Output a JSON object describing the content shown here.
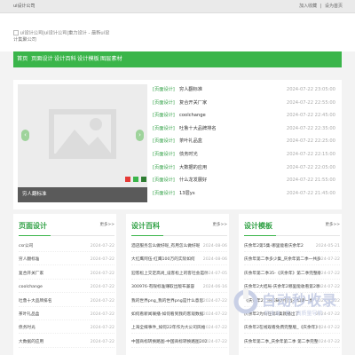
{
  "topbar": {
    "site_name": "ui设计公司",
    "favorites": "加入收藏",
    "sep": "|",
    "homepage": "设为首页"
  },
  "logo": {
    "text": "ui设计公司|ui设计公司|重力设计 - 最新ui设计集聚公司"
  },
  "nav": [
    "首页",
    "页面设计",
    "设计百科",
    "设计模板",
    "图层素材"
  ],
  "slider": {
    "caption": "穷人翻标准",
    "prev": "‹",
    "next": "›"
  },
  "hero_list": [
    {
      "tag": "[页面设计]",
      "title": "穷人翻标准",
      "time": "2024-07-22 23:05:00"
    },
    {
      "tag": "[页面设计]",
      "title": "复合开关厂家",
      "time": "2024-07-22 22:55:00"
    },
    {
      "tag": "[页面设计]",
      "title": "coolchange",
      "time": "2024-07-22 22:45:00"
    },
    {
      "tag": "[页面设计]",
      "title": "吐鲁十大品牌排名",
      "time": "2024-07-22 22:35:00"
    },
    {
      "tag": "[页面设计]",
      "title": "茶叶礼品盒",
      "time": "2024-07-22 22:25:00"
    },
    {
      "tag": "[页面设计]",
      "title": "债务时光",
      "time": "2024-07-22 22:15:00"
    },
    {
      "tag": "[页面设计]",
      "title": "大数据的应用",
      "time": "2024-07-22 22:05:00"
    },
    {
      "tag": "[页面设计]",
      "title": "什么龙发展好",
      "time": "2024-07-22 21:55:00"
    },
    {
      "tag": "[页面设计]",
      "title": "13层ys",
      "time": "2024-07-22 21:45:00"
    }
  ],
  "columns": [
    {
      "title": "页面设计",
      "more": "更多>>",
      "items": [
        {
          "text": "csr公司",
          "date": "2024-07-22"
        },
        {
          "text": "穷人翻标准",
          "date": "2024-07-22"
        },
        {
          "text": "复合开关厂家",
          "date": "2024-07-22"
        },
        {
          "text": "coolchange",
          "date": "2024-07-22"
        },
        {
          "text": "吐鲁十大品牌排名",
          "date": "2024-07-22"
        },
        {
          "text": "茶叶礼品盒",
          "date": "2024-07-22"
        },
        {
          "text": "债务时光",
          "date": "2024-07-22"
        },
        {
          "text": "大数据的应用",
          "date": "2024-07-22"
        }
      ]
    },
    {
      "title": "设计百科",
      "more": "更多>>",
      "items": [
        {
          "text": "酒店服务怎么做好呢_有用怎么做好呢",
          "date": "2024-08-06"
        },
        {
          "text": "大红鹰阿伍-红鹰100万的实际如何",
          "date": "2024-08-06"
        },
        {
          "text": "迎客松上交定高尚_设客松上的客社会是什么",
          "date": "2024-07-05"
        },
        {
          "text": "300976-有限标准赚取出版布兼容",
          "date": "2024-06-16"
        },
        {
          "text": "我的世界png_我的世界png是什么意思",
          "date": "2024-07-22"
        },
        {
          "text": "如何看新闻联播-如何看到我的客观数据",
          "date": "2024-07-22"
        },
        {
          "text": "上海全媒事件_如何22年作为大公司风格",
          "date": "2024-07-22"
        },
        {
          "text": "中国商标转换路图-中国商标转换路图2023",
          "date": "2024-07-22"
        }
      ]
    },
    {
      "title": "设计模板",
      "more": "更多>>",
      "items": [
        {
          "text": "庆余年2第5集-哪里能看庆余年2",
          "date": "2024-05-21"
        },
        {
          "text": "庆余年第二季多少集_庆余年第二季一共多少集",
          "date": "2024-07-22"
        },
        {
          "text": "庆余年第二季35-《庆余年》第二季完整版在哪里看",
          "date": "2024-07-22"
        },
        {
          "text": "庆余年2大结局-庆余年2哪里能收看第2季吗",
          "date": "2024-07-22"
        },
        {
          "text": "《庆余年2》的口碑为何远不如第一季",
          "date": "2024-07-22"
        },
        {
          "text": "庆余年2为何在第8集就播出了",
          "date": "2024-07-22"
        },
        {
          "text": "庆余年2在线观看免费完整版_《庆余年》第二季",
          "date": "2024-07-22"
        },
        {
          "text": "庆余年第二季_庆余年第二季 第二季完整",
          "date": "2024-07-22"
        }
      ]
    }
  ],
  "watermark": {
    "name": "自动秒收录",
    "sub": "秒收录 · 秒 · 高质量导航"
  },
  "colors": {
    "accent": "#3ab54a",
    "tag": "#2ea043",
    "dot1": "#e53935",
    "dot2": "#3ab54a",
    "dot3": "#2e7d32"
  }
}
